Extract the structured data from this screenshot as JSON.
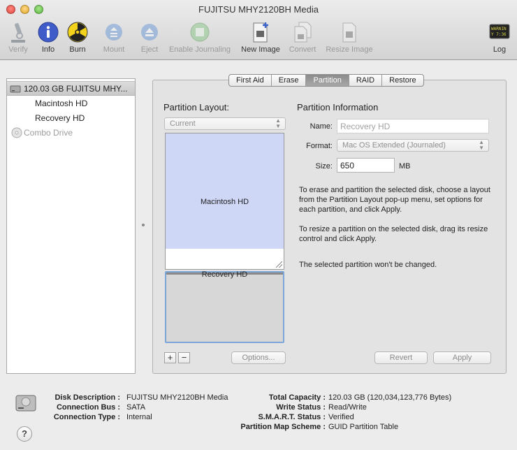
{
  "window": {
    "title": "FUJITSU MHY2120BH Media"
  },
  "toolbar": {
    "verify": "Verify",
    "info": "Info",
    "burn": "Burn",
    "mount": "Mount",
    "eject": "Eject",
    "enable_journaling": "Enable Journaling",
    "new_image": "New Image",
    "convert": "Convert",
    "resize_image": "Resize Image",
    "log": "Log",
    "log_icon_text": "WARNIN\nY 7:36"
  },
  "sidebar": {
    "items": [
      {
        "label": "120.03 GB FUJITSU MHY...",
        "icon": "hard-drive-icon"
      },
      {
        "label": "Macintosh HD",
        "icon": "none"
      },
      {
        "label": "Recovery HD",
        "icon": "none"
      },
      {
        "label": "Combo Drive",
        "icon": "optical-drive-icon"
      }
    ]
  },
  "tabs": [
    "First Aid",
    "Erase",
    "Partition",
    "RAID",
    "Restore"
  ],
  "partition_layout": {
    "title": "Partition Layout:",
    "popup_value": "Current",
    "partitions": [
      {
        "name": "Macintosh HD"
      },
      {
        "name": "Recovery HD"
      }
    ],
    "add_symbol": "+",
    "remove_symbol": "−",
    "options_button": "Options..."
  },
  "partition_information": {
    "title": "Partition Information",
    "name_label": "Name:",
    "name_value": "Recovery HD",
    "format_label": "Format:",
    "format_value": "Mac OS Extended (Journaled)",
    "size_label": "Size:",
    "size_value": "650",
    "size_unit": "MB",
    "help_erase": "To erase and partition the selected disk, choose a layout from the Partition Layout pop-up menu, set options for each partition, and click Apply.",
    "help_resize": "To resize a partition on the selected disk, drag its resize control and click Apply.",
    "status": "The selected partition won't be changed.",
    "revert_button": "Revert",
    "apply_button": "Apply"
  },
  "footer": {
    "disk_description_label": "Disk Description :",
    "disk_description_value": "FUJITSU MHY2120BH Media",
    "connection_bus_label": "Connection Bus :",
    "connection_bus_value": "SATA",
    "connection_type_label": "Connection Type :",
    "connection_type_value": "Internal",
    "total_capacity_label": "Total Capacity :",
    "total_capacity_value": "120.03 GB (120,034,123,776 Bytes)",
    "write_status_label": "Write Status :",
    "write_status_value": "Read/Write",
    "smart_status_label": "S.M.A.R.T. Status :",
    "smart_status_value": "Verified",
    "partition_map_label": "Partition Map Scheme :",
    "partition_map_value": "GUID Partition Table",
    "help_symbol": "?"
  }
}
